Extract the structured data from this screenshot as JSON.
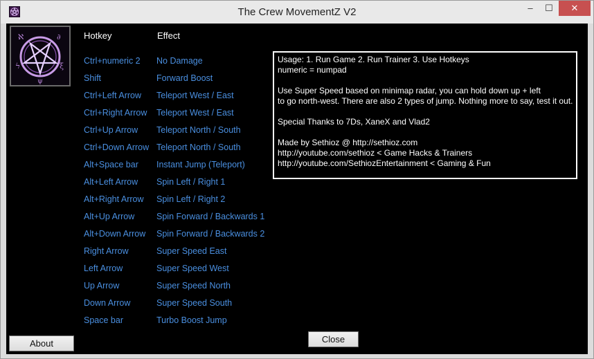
{
  "window": {
    "title": "The Crew MovementZ V2",
    "icon": "pentagram-icon",
    "controls": {
      "minimize": "–",
      "maximize": "☐",
      "close": "✕"
    }
  },
  "sidebar": {
    "logo": "pentagram-logo",
    "about_label": "About"
  },
  "table": {
    "headers": {
      "hotkey": "Hotkey",
      "effect": "Effect"
    },
    "rows": [
      {
        "hotkey": "Ctrl+numeric 2",
        "effect": "No Damage"
      },
      {
        "hotkey": "Shift",
        "effect": "Forward Boost"
      },
      {
        "hotkey": "Ctrl+Left Arrow",
        "effect": "Teleport West / East"
      },
      {
        "hotkey": "Ctrl+Right Arrow",
        "effect": "Teleport West / East"
      },
      {
        "hotkey": "Ctrl+Up Arrow",
        "effect": "Teleport North / South"
      },
      {
        "hotkey": "Ctrl+Down Arrow",
        "effect": "Teleport North / South"
      },
      {
        "hotkey": "Alt+Space bar",
        "effect": "Instant Jump (Teleport)"
      },
      {
        "hotkey": "Alt+Left Arrow",
        "effect": "Spin Left / Right 1"
      },
      {
        "hotkey": "Alt+Right Arrow",
        "effect": "Spin Left / Right 2"
      },
      {
        "hotkey": "Alt+Up Arrow",
        "effect": "Spin Forward / Backwards 1"
      },
      {
        "hotkey": "Alt+Down Arrow",
        "effect": "Spin Forward / Backwards 2"
      },
      {
        "hotkey": "Right Arrow",
        "effect": "Super Speed East"
      },
      {
        "hotkey": "Left Arrow",
        "effect": "Super Speed West"
      },
      {
        "hotkey": "Up Arrow",
        "effect": "Super Speed North"
      },
      {
        "hotkey": "Down Arrow",
        "effect": "Super Speed South"
      },
      {
        "hotkey": "Space bar",
        "effect": "Turbo Boost Jump"
      }
    ]
  },
  "info": {
    "lines": [
      "Usage:  1. Run Game  2. Run Trainer  3. Use Hotkeys",
      "numeric = numpad",
      "",
      "Use Super Speed based on minimap radar, you can hold down up + left",
      "to go north-west. There are also 2 types of jump. Nothing more to say, test it out.",
      "",
      "Special Thanks to 7Ds, XaneX and Vlad2",
      "",
      "Made by Sethioz @ http://sethioz.com",
      "http://youtube.com/sethioz < Game Hacks & Trainers",
      "http://youtube.com/SethiozEntertainment < Gaming & Fun"
    ]
  },
  "buttons": {
    "close_label": "Close"
  },
  "colors": {
    "link_blue": "#4a8fe0",
    "background": "#000000",
    "title_bar": "#e9e9e9",
    "close_red": "#c75050"
  }
}
